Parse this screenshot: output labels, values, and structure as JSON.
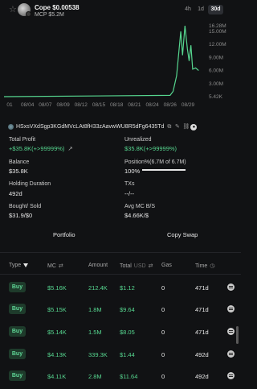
{
  "token": {
    "name": "Cope",
    "price": "$0.00538",
    "mcap": "MCP $5.2M"
  },
  "timeframes": [
    {
      "label": "4h",
      "active": false
    },
    {
      "label": "1d",
      "active": false
    },
    {
      "label": "30d",
      "active": true
    }
  ],
  "chart_data": {
    "type": "line",
    "x_ticks": [
      "01",
      "08/04",
      "08/07",
      "08/09",
      "08/12",
      "08/15",
      "08/18",
      "08/21",
      "08/24",
      "08/26",
      "08/29"
    ],
    "y_ticks": [
      "16.28M",
      "15.00M",
      "12.00M",
      "9.00M",
      "6.00M",
      "3.00M",
      "5.42K"
    ],
    "ylim": [
      0,
      16.28
    ],
    "y_unit": "M",
    "x": [
      "08/26",
      "08/26",
      "08/27",
      "08/27",
      "08/28",
      "08/28",
      "08/28",
      "08/29",
      "08/29",
      "08/29",
      "08/29",
      "08/30",
      "08/30"
    ],
    "values": [
      0.005,
      0.3,
      1.2,
      4.8,
      15.0,
      9.5,
      16.28,
      11.0,
      8.2,
      11.8,
      6.3,
      6.6,
      6.0
    ],
    "line_color": "#56d68f"
  },
  "wallet": {
    "address": "HSxsVXdSgp3KGdMVcLAt8fH33zAavwWU8R5dFg6435Td"
  },
  "stats": {
    "total_profit_label": "Total Profit",
    "total_profit_value": "+$35.8K(+>99999%)",
    "unrealized_label": "Unrealized",
    "unrealized_value": "$35.8K(+>99999%)",
    "balance_label": "Balance",
    "balance_value": "$35.8K",
    "position_label": "Position%(6.7M of 6.7M)",
    "position_value": "100%",
    "position_fraction": 1.0,
    "holding_label": "Holding Duration",
    "holding_value": "492d",
    "txs_label": "TXs",
    "txs_value": "--/--",
    "bought_label": "Bought/ Sold",
    "bought_value": "$31.9/$0",
    "avgmc_label": "Avg MC B/S",
    "avgmc_value": "$4.66K/$"
  },
  "actions": {
    "portfolio": "Portfolio",
    "copy_swap": "Copy Swap"
  },
  "table": {
    "headers": {
      "type": "Type",
      "mc": "MC",
      "amount": "Amount",
      "total": "Total",
      "total_unit": "USD",
      "gas": "Gas",
      "time": "Time"
    },
    "rows": [
      {
        "type": "Buy",
        "mc": "$5.16K",
        "amount": "212.4K",
        "total": "$1.12",
        "gas": "0",
        "time": "471d"
      },
      {
        "type": "Buy",
        "mc": "$5.15K",
        "amount": "1.8M",
        "total": "$9.64",
        "gas": "0",
        "time": "471d"
      },
      {
        "type": "Buy",
        "mc": "$5.14K",
        "amount": "1.5M",
        "total": "$8.05",
        "gas": "0",
        "time": "471d"
      },
      {
        "type": "Buy",
        "mc": "$4.13K",
        "amount": "339.3K",
        "total": "$1.44",
        "gas": "0",
        "time": "492d"
      },
      {
        "type": "Buy",
        "mc": "$4.11K",
        "amount": "2.8M",
        "total": "$11.64",
        "gas": "0",
        "time": "492d"
      }
    ]
  }
}
